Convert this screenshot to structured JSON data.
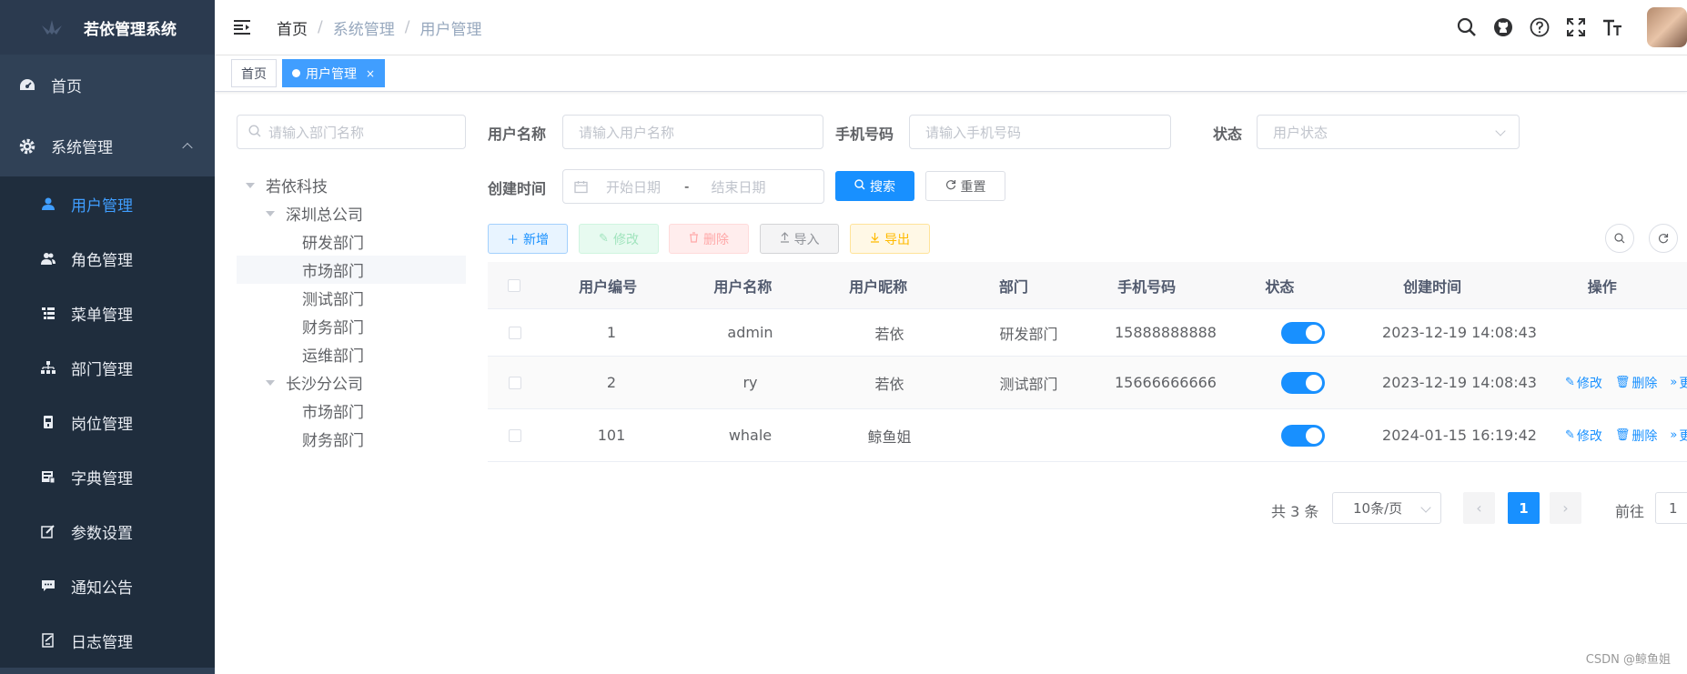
{
  "app": {
    "title": "若依管理系统"
  },
  "sidebar": {
    "items": [
      {
        "label": "首页",
        "icon": "dashboard-icon"
      },
      {
        "label": "系统管理",
        "icon": "gear-icon",
        "expanded": true
      }
    ],
    "submenu": [
      {
        "label": "用户管理",
        "icon": "user-icon",
        "active": true
      },
      {
        "label": "角色管理",
        "icon": "peoples-icon"
      },
      {
        "label": "菜单管理",
        "icon": "tree-table-icon"
      },
      {
        "label": "部门管理",
        "icon": "tree-icon"
      },
      {
        "label": "岗位管理",
        "icon": "post-icon"
      },
      {
        "label": "字典管理",
        "icon": "dict-icon"
      },
      {
        "label": "参数设置",
        "icon": "edit-icon"
      },
      {
        "label": "通知公告",
        "icon": "message-icon"
      }
    ],
    "log": {
      "label": "日志管理",
      "icon": "log-icon"
    }
  },
  "navbar": {
    "breadcrumb": [
      "首页",
      "系统管理",
      "用户管理"
    ],
    "separator": "/"
  },
  "tags": [
    {
      "label": "首页",
      "active": false
    },
    {
      "label": "用户管理",
      "active": true,
      "close": "×"
    }
  ],
  "dept": {
    "search_placeholder": "请输入部门名称",
    "tree": [
      {
        "label": "若依科技",
        "level": 0,
        "caret": true
      },
      {
        "label": "深圳总公司",
        "level": 1,
        "caret": true
      },
      {
        "label": "研发部门",
        "level": 2
      },
      {
        "label": "市场部门",
        "level": 2,
        "highlighted": true
      },
      {
        "label": "测试部门",
        "level": 2
      },
      {
        "label": "财务部门",
        "level": 2
      },
      {
        "label": "运维部门",
        "level": 2
      },
      {
        "label": "长沙分公司",
        "level": 1,
        "caret": true
      },
      {
        "label": "市场部门",
        "level": 2
      },
      {
        "label": "财务部门",
        "level": 2
      }
    ]
  },
  "form": {
    "username_label": "用户名称",
    "username_placeholder": "请输入用户名称",
    "phone_label": "手机号码",
    "phone_placeholder": "请输入手机号码",
    "status_label": "状态",
    "status_placeholder": "用户状态",
    "created_label": "创建时间",
    "start_placeholder": "开始日期",
    "range_sep": "-",
    "end_placeholder": "结束日期",
    "search_btn": "搜索",
    "reset_btn": "重置"
  },
  "toolbar": {
    "add": "新增",
    "edit": "修改",
    "delete": "删除",
    "import": "导入",
    "export": "导出"
  },
  "table": {
    "columns": [
      "用户编号",
      "用户名称",
      "用户昵称",
      "部门",
      "手机号码",
      "状态",
      "创建时间",
      "操作"
    ],
    "rows": [
      {
        "id": "1",
        "username": "admin",
        "nickname": "若依",
        "dept": "研发部门",
        "phone": "15888888888",
        "status": true,
        "created": "2023-12-19 14:08:43",
        "ops": false
      },
      {
        "id": "2",
        "username": "ry",
        "nickname": "若依",
        "dept": "测试部门",
        "phone": "15666666666",
        "status": true,
        "created": "2023-12-19 14:08:43",
        "ops": true
      },
      {
        "id": "101",
        "username": "whale",
        "nickname": "鲸鱼姐",
        "dept": "",
        "phone": "",
        "status": true,
        "created": "2024-01-15 16:19:42",
        "ops": true
      }
    ],
    "op_edit": "修改",
    "op_delete": "删除",
    "op_more": "更"
  },
  "pagination": {
    "total": "共 3 条",
    "page_size": "10条/页",
    "current": "1",
    "goto_label": "前往",
    "goto_value": "1"
  },
  "watermark": "CSDN @鲸鱼姐",
  "colors": {
    "sidebar": "#304156",
    "accent": "#1890ff",
    "submenu": "#1f2d3d"
  }
}
